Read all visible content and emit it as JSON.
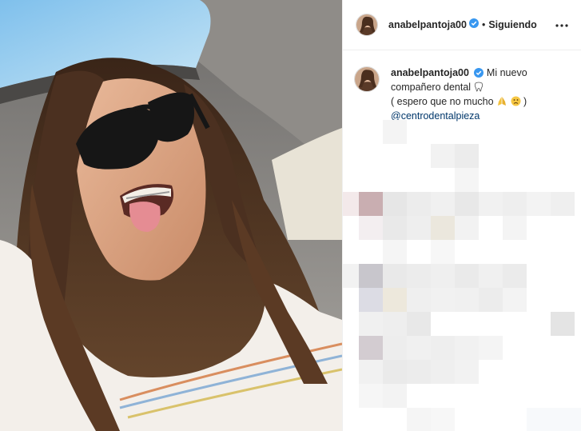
{
  "post": {
    "photo_alt": "",
    "username": "anabelpantoja00",
    "separator": "•",
    "follow_label": "Siguiendo",
    "caption_lines": [
      "Mi nuevo",
      "compañero dental",
      "( espero que no mucho"
    ],
    "mention": "@centrodentalpieza"
  },
  "icons": {
    "verified": "verified-badge-icon",
    "more": "more-options-icon",
    "tooth": "tooth-emoji",
    "pray": "pray-emoji",
    "sad": "slightly-frowning-emoji"
  },
  "colors": {
    "verified_blue": "#3897f0",
    "mention": "#00376b",
    "text": "#262626",
    "border": "#efefef"
  }
}
